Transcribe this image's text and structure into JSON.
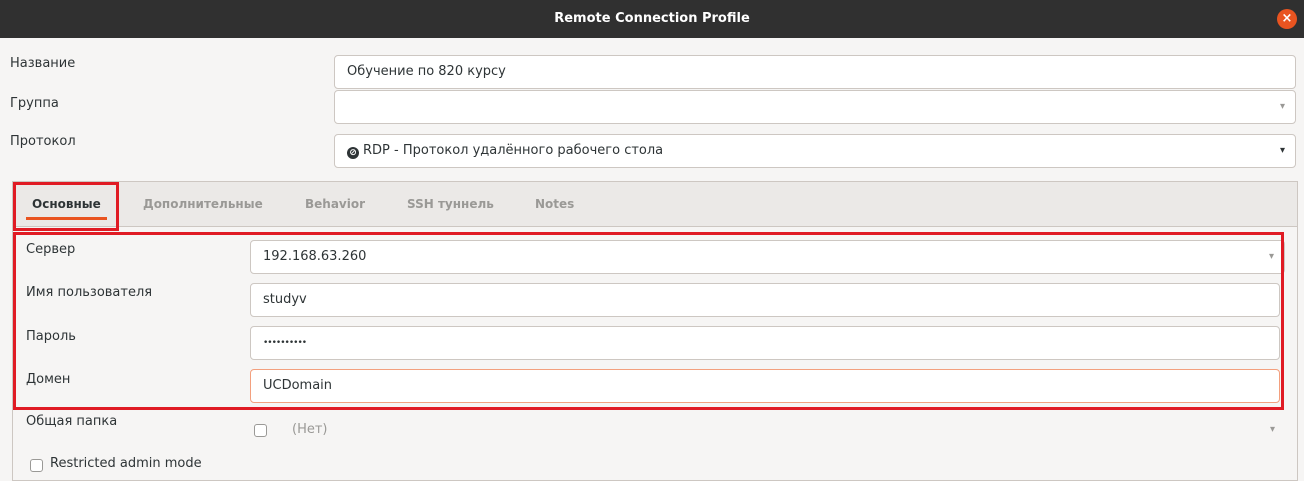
{
  "window": {
    "title": "Remote Connection Profile",
    "close_icon": "×"
  },
  "form": {
    "name_label": "Название",
    "name_value": "Обучение по 820 курсу",
    "group_label": "Группа",
    "group_value": "",
    "protocol_label": "Протокол",
    "protocol_value": "RDP - Протокол удалённого рабочего стола",
    "dropdown_arrow": "▾"
  },
  "tabs": [
    {
      "label": "Основные"
    },
    {
      "label": "Дополнительные"
    },
    {
      "label": "Behavior"
    },
    {
      "label": "SSH туннель"
    },
    {
      "label": "Notes"
    }
  ],
  "basic": {
    "server_label": "Сервер",
    "server_value": "192.168.63.260",
    "username_label": "Имя пользователя",
    "username_value": "studyv",
    "password_label": "Пароль",
    "password_value": "••••••••••",
    "domain_label": "Домен",
    "domain_value": "UCDomain",
    "share_label": "Общая папка",
    "share_value": "(Нет)",
    "restricted_label": "Restricted admin mode"
  },
  "colors": {
    "highlight": "#e01b24",
    "accent": "#e95420",
    "titlebar": "#303030"
  }
}
